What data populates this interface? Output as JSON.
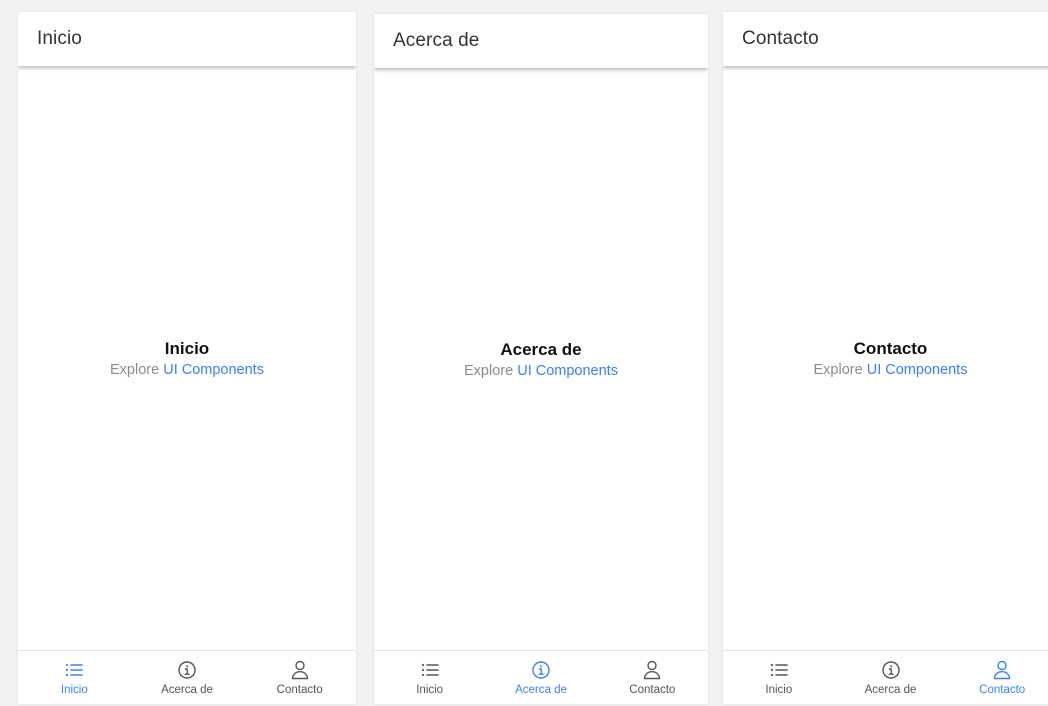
{
  "accent_color": "#3880ff",
  "screens": [
    {
      "header_title": "Inicio",
      "content_title": "Inicio",
      "content_prefix": "Explore",
      "content_link": "UI Components",
      "active_tab": 0
    },
    {
      "header_title": "Acerca de",
      "content_title": "Acerca de",
      "content_prefix": "Explore",
      "content_link": "UI Components",
      "active_tab": 1
    },
    {
      "header_title": "Contacto",
      "content_title": "Contacto",
      "content_prefix": "Explore",
      "content_link": "UI Components",
      "active_tab": 2
    }
  ],
  "tabs": [
    {
      "label": "Inicio",
      "icon": "list-icon"
    },
    {
      "label": "Acerca de",
      "icon": "info-circle-icon"
    },
    {
      "label": "Contacto",
      "icon": "person-icon"
    }
  ]
}
